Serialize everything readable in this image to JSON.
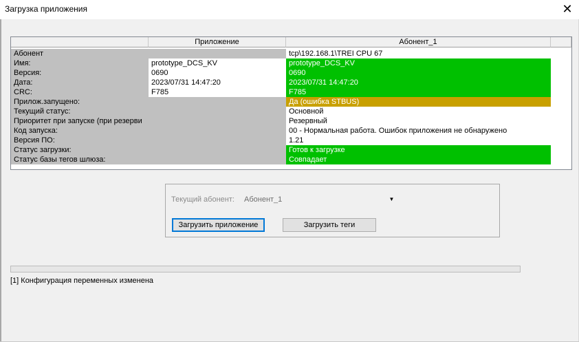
{
  "window": {
    "title": "Загрузка приложения"
  },
  "grid": {
    "headers": [
      "",
      "Приложение",
      "Абонент_1"
    ],
    "rows": [
      {
        "label": "Абонент",
        "app": "",
        "sub": "tcp\\192.168.1\\TREI CPU 67",
        "app_style": "gray",
        "sub_style": "white"
      },
      {
        "label": "Имя:",
        "app": "prototype_DCS_KV",
        "sub": "prototype_DCS_KV",
        "app_style": "white",
        "sub_style": "green"
      },
      {
        "label": "Версия:",
        "app": "0690",
        "sub": "0690",
        "app_style": "white",
        "sub_style": "green"
      },
      {
        "label": "Дата:",
        "app": "2023/07/31 14:47:20",
        "sub": "2023/07/31 14:47:20",
        "app_style": "white",
        "sub_style": "green"
      },
      {
        "label": "CRC:",
        "app": "F785",
        "sub": "F785",
        "app_style": "white",
        "sub_style": "green"
      },
      {
        "label": "Прилож.запущено:",
        "app": "",
        "sub": "Да (ошибка STBUS)",
        "app_style": "gray",
        "sub_style": "amber"
      },
      {
        "label": "Текущий статус:",
        "app": "",
        "sub": "Основной",
        "app_style": "gray",
        "sub_style": "white"
      },
      {
        "label": "Приоритет при запуске (при резерви",
        "app": "",
        "sub": "Резервный",
        "app_style": "gray",
        "sub_style": "white"
      },
      {
        "label": "Код запуска:",
        "app": "",
        "sub": "00 - Нормальная работа. Ошибок приложения не обнаружено",
        "app_style": "gray",
        "sub_style": "white"
      },
      {
        "label": "Версия ПО:",
        "app": "",
        "sub": "1.21",
        "app_style": "gray",
        "sub_style": "white"
      },
      {
        "label": "Статус загрузки:",
        "app": "",
        "sub": "Готов к загрузке",
        "app_style": "gray",
        "sub_style": "green"
      },
      {
        "label": "Статус базы тегов шлюза:",
        "app": "",
        "sub": "Совпадает",
        "app_style": "gray",
        "sub_style": "green"
      }
    ]
  },
  "panel": {
    "current_label": "Текущий абонент:",
    "current_value": "Абонент_1",
    "load_app_button": "Загрузить приложение",
    "load_tags_button": "Загрузить теги"
  },
  "progress": {
    "value": 0
  },
  "status": {
    "message": "[1] Конфигурация переменных изменена"
  },
  "colors": {
    "ok": "#00c000",
    "warning": "#c8a000",
    "label_bg": "#c0c0c0",
    "focus": "#0078d7"
  },
  "icons": {
    "close": "close-icon",
    "dropdown": "chevron-down-icon"
  }
}
